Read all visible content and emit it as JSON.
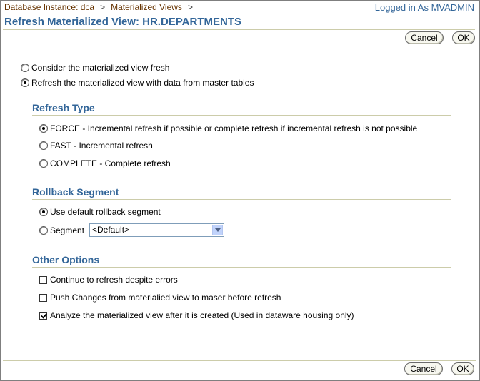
{
  "breadcrumb": {
    "item1": "Database Instance: dca",
    "sep1": ">",
    "item2": "Materialized Views",
    "sep2": ">"
  },
  "user": {
    "logged_in": "Logged in As MVADMIN"
  },
  "page_title": "Refresh Materialized View: HR.DEPARTMENTS",
  "buttons": {
    "cancel": "Cancel",
    "ok": "OK"
  },
  "mode": {
    "consider_fresh": "Consider the materialized view fresh",
    "refresh_from_master": "Refresh the materialized view with data from master tables",
    "selected": "refresh_from_master"
  },
  "refresh_type": {
    "heading": "Refresh Type",
    "force": "FORCE - Incremental refresh if possible or complete refresh if incremental refresh is not possible",
    "fast": "FAST - Incremental refresh",
    "complete": "COMPLETE - Complete refresh",
    "selected": "force"
  },
  "rollback": {
    "heading": "Rollback Segment",
    "use_default": "Use default rollback segment",
    "segment_label": "Segment",
    "segment_value": "<Default>",
    "selected": "use_default"
  },
  "other_options": {
    "heading": "Other Options",
    "continue_despite_errors": {
      "label": "Continue to refresh despite errors",
      "checked": false
    },
    "push_changes": {
      "label": "Push Changes from materialied view to maser before refresh",
      "checked": false
    },
    "analyze": {
      "label": "Analyze the materialized view after it is created (Used in dataware housing only)",
      "checked": true
    }
  },
  "colors": {
    "heading": "#336699",
    "link": "#663300",
    "rule": "#ccccaa"
  }
}
